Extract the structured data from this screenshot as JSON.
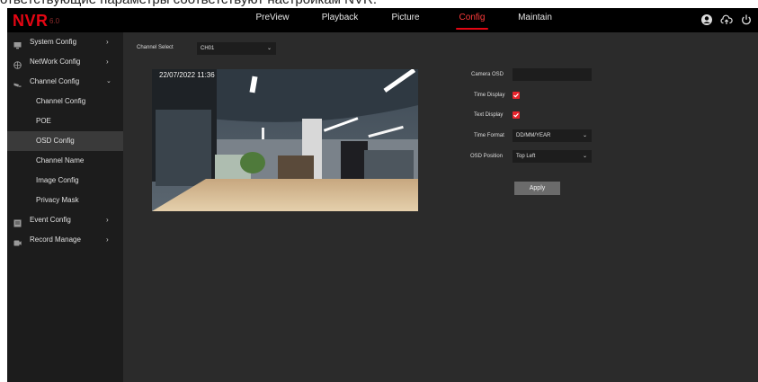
{
  "top_caption": "ответствующие параметры соответствуют настройкам NVR.",
  "brand": {
    "logo": "NVR",
    "version": "6.0",
    "color": "#e30613"
  },
  "nav": {
    "items": [
      {
        "label": "PreView"
      },
      {
        "label": "Playback"
      },
      {
        "label": "Picture"
      },
      {
        "label": "Config",
        "active": true
      },
      {
        "label": "Maintain"
      }
    ],
    "icons": [
      "user-icon",
      "cloud-upload-icon",
      "power-icon"
    ]
  },
  "sidebar": {
    "items": [
      {
        "label": "System Config",
        "icon": "monitor-icon",
        "expandable": true
      },
      {
        "label": "NetWork Config",
        "icon": "globe-icon",
        "expandable": true
      },
      {
        "label": "Channel Config",
        "icon": "camera-icon",
        "expanded": true
      },
      {
        "label": "Channel Config",
        "sub": true
      },
      {
        "label": "POE",
        "sub": true
      },
      {
        "label": "OSD Config",
        "sub": true,
        "active": true
      },
      {
        "label": "Channel Name",
        "sub": true
      },
      {
        "label": "Image Config",
        "sub": true
      },
      {
        "label": "Privacy Mask",
        "sub": true
      },
      {
        "label": "Event Config",
        "icon": "event-icon",
        "expandable": true
      },
      {
        "label": "Record Manage",
        "icon": "record-icon",
        "expandable": true
      }
    ]
  },
  "channel_select": {
    "label": "Channel Select",
    "value": "CH01"
  },
  "preview": {
    "osd_time": "22/07/2022  11:36"
  },
  "osd_form": {
    "camera_osd": {
      "label": "Camera OSD",
      "value": ""
    },
    "time_display": {
      "label": "Time Display",
      "checked": true
    },
    "text_display": {
      "label": "Text Display",
      "checked": true
    },
    "time_format": {
      "label": "Time Format",
      "value": "DD/MM/YEAR"
    },
    "osd_position": {
      "label": "OSD Position",
      "value": "Top Left"
    },
    "apply_label": "Apply"
  }
}
